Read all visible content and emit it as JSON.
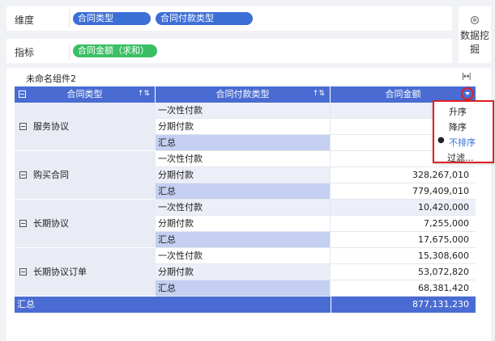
{
  "config": {
    "dimension_label": "维度",
    "dimension_pills": [
      "合同类型",
      "合同付款类型"
    ],
    "metric_label": "指标",
    "metric_pills": [
      "合同金额（求和）"
    ],
    "mining_button": "数据挖掘",
    "mining_icon": "data-mining-icon"
  },
  "component": {
    "title": "未命名组件2",
    "width_icon": "expand-width-icon"
  },
  "table": {
    "headers": [
      "合同类型",
      "合同付款类型",
      "合同金额"
    ],
    "groups": [
      {
        "name": "服务协议",
        "rows": [
          {
            "type": "一次性付款",
            "amount": "4,"
          },
          {
            "type": "分期付款",
            "amount": "7,"
          },
          {
            "type": "汇总",
            "amount": "11,"
          }
        ]
      },
      {
        "name": "购买合同",
        "rows": [
          {
            "type": "一次性付款",
            "amount": "451,"
          },
          {
            "type": "分期付款",
            "amount": "328,267,010"
          },
          {
            "type": "汇总",
            "amount": "779,409,010"
          }
        ]
      },
      {
        "name": "长期协议",
        "rows": [
          {
            "type": "一次性付款",
            "amount": "10,420,000"
          },
          {
            "type": "分期付款",
            "amount": "7,255,000"
          },
          {
            "type": "汇总",
            "amount": "17,675,000"
          }
        ]
      },
      {
        "name": "长期协议订单",
        "rows": [
          {
            "type": "一次性付款",
            "amount": "15,308,600"
          },
          {
            "type": "分期付款",
            "amount": "53,072,820"
          },
          {
            "type": "汇总",
            "amount": "68,381,420"
          }
        ]
      }
    ],
    "grand_total_label": "汇总",
    "grand_total_value": "877,131,230"
  },
  "sort_menu": {
    "items": [
      "升序",
      "降序",
      "不排序"
    ],
    "selected": "不排序",
    "filter": "过滤..."
  },
  "colors": {
    "header_blue": "#4a6cd2",
    "pill_blue": "#3c6fd6",
    "pill_green": "#3bbf65",
    "highlight_red": "#e02020"
  }
}
